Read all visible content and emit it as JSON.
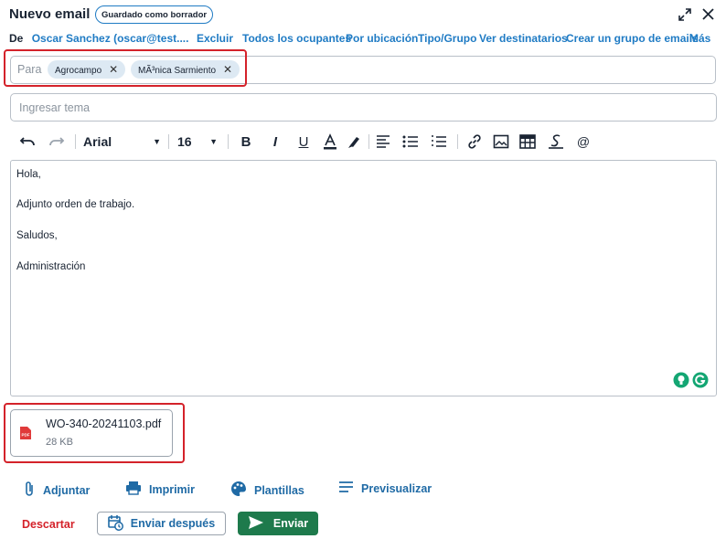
{
  "header": {
    "title": "Nuevo email",
    "draft_badge": "Guardado como borrador"
  },
  "from": {
    "label": "De",
    "sender": "Oscar Sanchez (oscar@test....",
    "links": [
      "Excluir",
      "Todos los ocupantes",
      "Por ubicación",
      "Tipo/Grupo",
      "Ver destinatarios",
      "Crear un grupo de emails",
      "Más"
    ]
  },
  "to": {
    "label": "Para",
    "recipients": [
      "Agrocampo",
      "MÃ³nica Sarmiento"
    ]
  },
  "subject": {
    "placeholder": "Ingresar tema"
  },
  "toolbar": {
    "font_family": "Arial",
    "font_size": "16"
  },
  "body": {
    "lines": [
      "Hola,",
      "Adjunto orden de trabajo.",
      "Saludos,",
      "Administración"
    ]
  },
  "attachment": {
    "name": "WO-340-20241103.pdf",
    "size": "28 KB",
    "type_label": "PDF"
  },
  "actions": {
    "attach": "Adjuntar",
    "print": "Imprimir",
    "templates": "Plantillas",
    "preview": "Previsualizar"
  },
  "footer": {
    "discard": "Descartar",
    "send_later": "Enviar después",
    "send": "Enviar"
  },
  "colors": {
    "link": "#1f7bc4",
    "highlight_border": "#d4222a",
    "send_button": "#1e7a4c",
    "chip": "#dde9f3"
  }
}
